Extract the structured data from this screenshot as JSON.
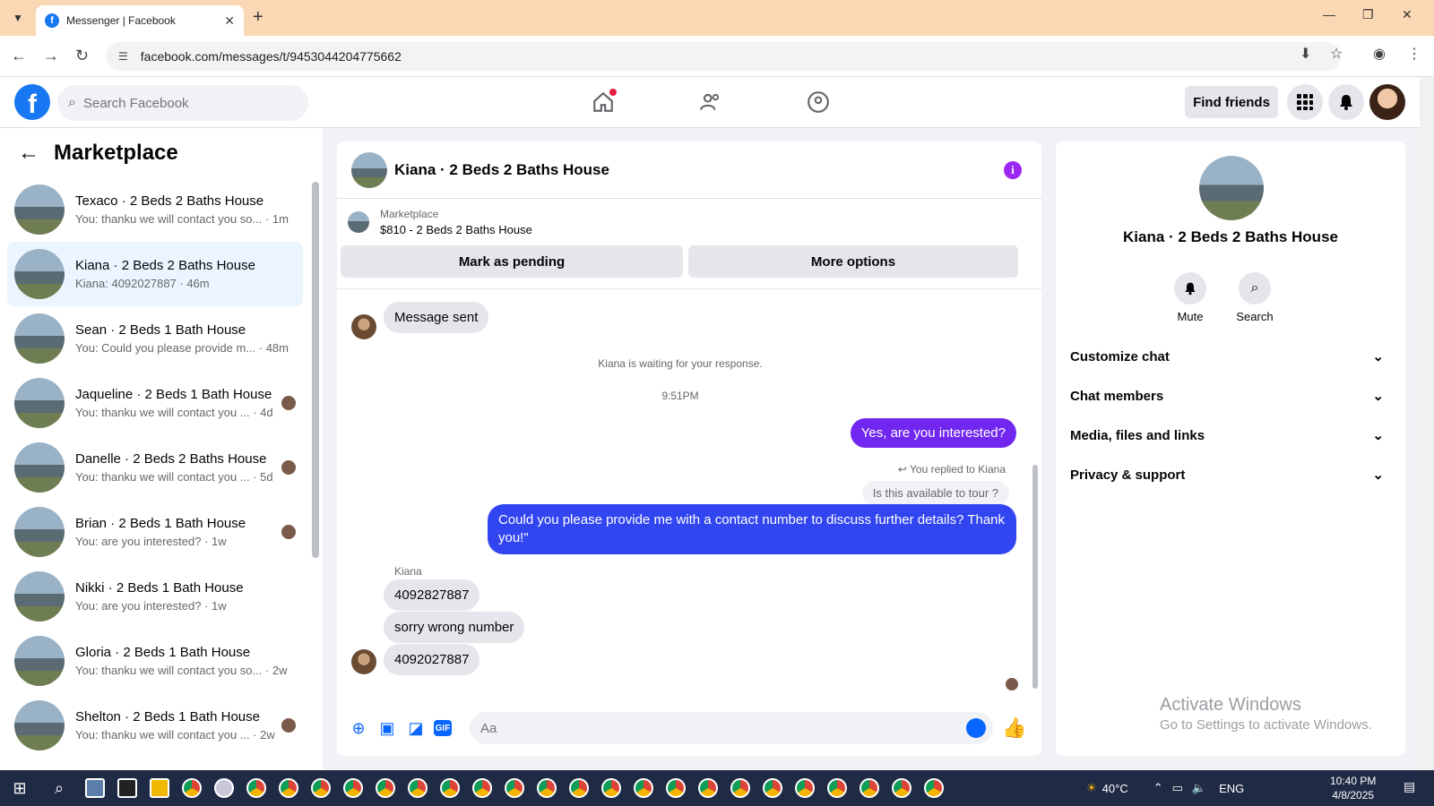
{
  "browser": {
    "tab_title": "Messenger | Facebook",
    "url": "facebook.com/messages/t/9453044204775662"
  },
  "header": {
    "search_placeholder": "Search Facebook",
    "find_friends": "Find friends"
  },
  "sidebar": {
    "title": "Marketplace",
    "conversations": [
      {
        "name": "Texaco · 2 Beds 2 Baths House",
        "snippet": "You: thanku we will contact you so... · 1m"
      },
      {
        "name": "Kiana · 2 Beds 2 Baths House",
        "snippet": "Kiana: 4092027887 · 46m",
        "active": true
      },
      {
        "name": "Sean · 2 Beds 1 Bath House",
        "snippet": "You: Could you please provide m... · 48m"
      },
      {
        "name": "Jaqueline · 2 Beds 1 Bath House",
        "snippet": "You: thanku we will contact you ... · 4d"
      },
      {
        "name": "Danelle · 2 Beds 2 Baths House",
        "snippet": "You: thanku we will contact you ... · 5d"
      },
      {
        "name": "Brian · 2 Beds 1 Bath House",
        "snippet": "You: are you interested? · 1w"
      },
      {
        "name": "Nikki · 2 Beds 1 Bath House",
        "snippet": "You: are you interested? · 1w"
      },
      {
        "name": "Gloria · 2 Beds 1 Bath House",
        "snippet": "You: thanku we will contact you so... · 2w"
      },
      {
        "name": "Shelton · 2 Beds 1 Bath House",
        "snippet": "You: thanku we will contact you ... · 2w"
      }
    ]
  },
  "chat": {
    "title": "Kiana · 2 Beds 2 Baths House",
    "marketplace_label": "Marketplace",
    "listing": "$810 - 2 Beds 2 Baths House",
    "mark_pending": "Mark as pending",
    "more_options": "More options",
    "messages": {
      "message_sent": "Message sent",
      "waiting": "Kiana is waiting for your response.",
      "time": "9:51PM",
      "out1": "Yes, are you interested?",
      "replied": "You replied to Kiana",
      "quoted": "Is this available to tour ?",
      "out2": "Could you please provide me with a contact number to discuss further details? Thank you!\"",
      "sender": "Kiana",
      "in1": "4092827887",
      "in2": "sorry wrong number",
      "in3": "4092027887"
    },
    "composer_placeholder": "Aa"
  },
  "info": {
    "name": "Kiana · 2 Beds 2 Baths House",
    "mute": "Mute",
    "search": "Search",
    "rows": [
      "Customize chat",
      "Chat members",
      "Media, files and links",
      "Privacy & support"
    ],
    "watermark_title": "Activate Windows",
    "watermark_sub": "Go to Settings to activate Windows."
  },
  "taskbar": {
    "temperature": "40°C",
    "lang": "ENG",
    "time": "10:40 PM",
    "date": "4/8/2025"
  },
  "colors": {
    "fb_blue": "#1877f2",
    "outgoing_purple": "#7127f0",
    "outgoing_blue": "#3145f0",
    "tab_bar": "#fbd8b4"
  }
}
